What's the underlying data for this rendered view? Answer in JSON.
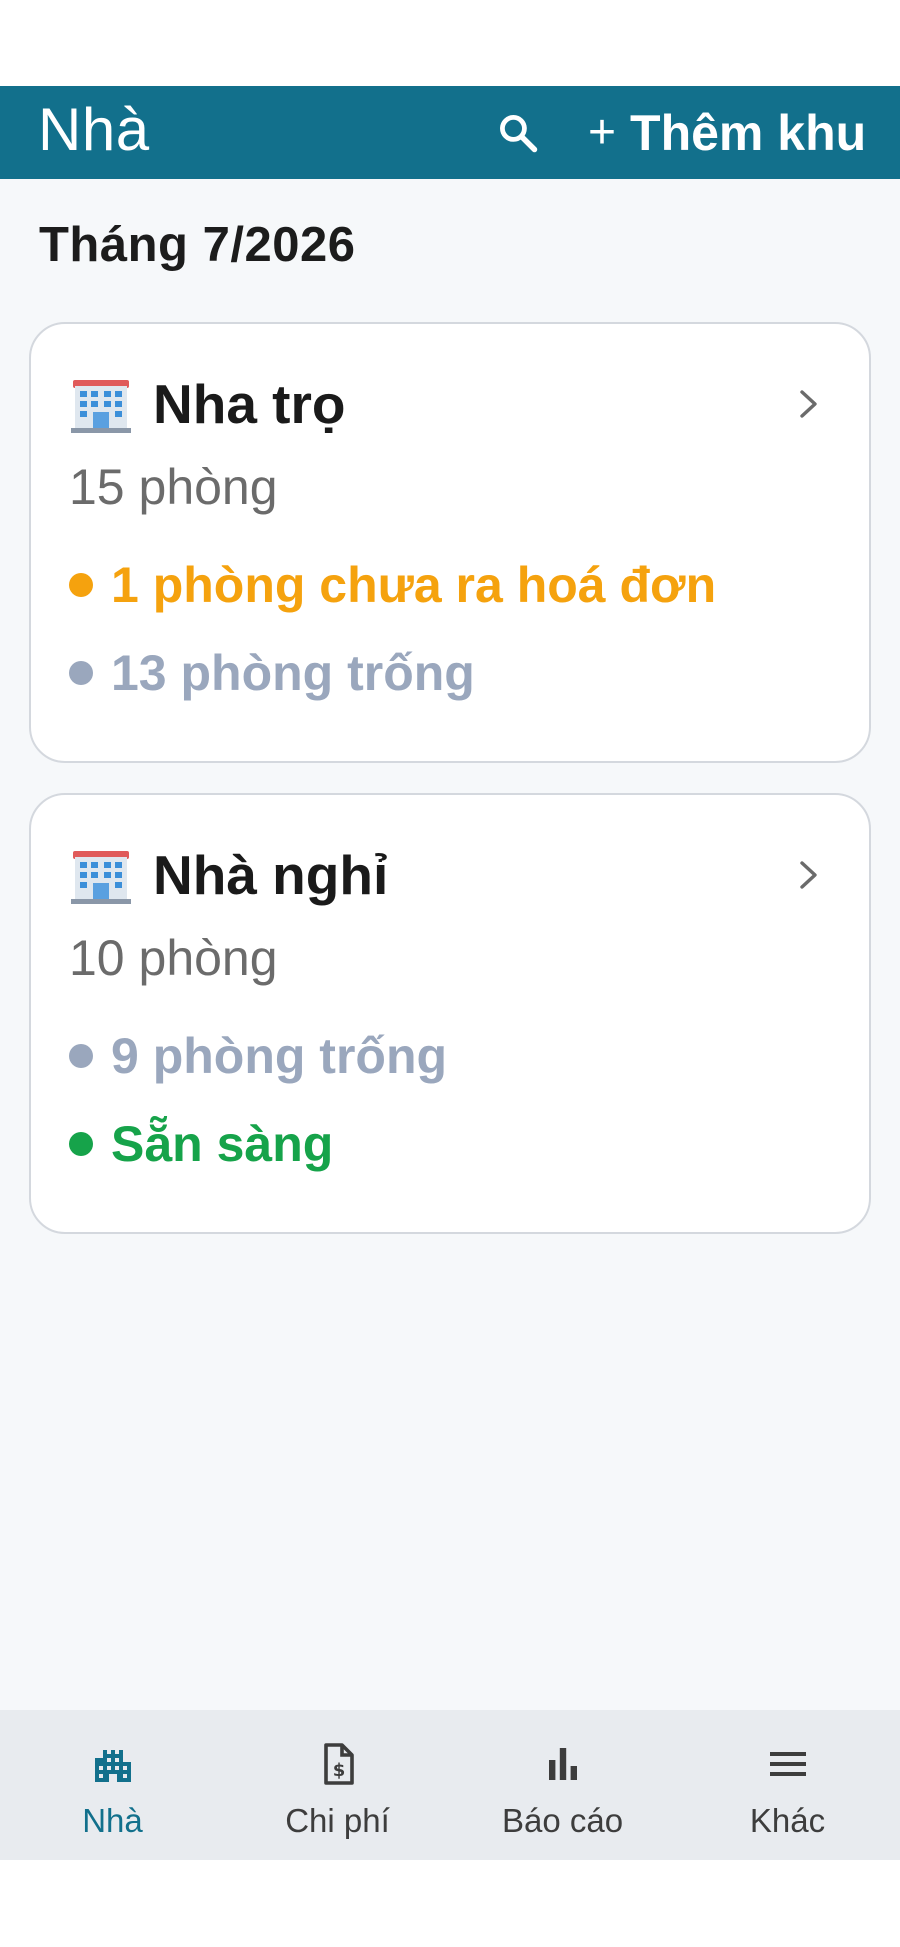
{
  "app_bar": {
    "title": "Nhà",
    "search_icon": "search-icon",
    "add_icon": "plus-icon",
    "add_label": "Thêm khu",
    "background": "#12708c"
  },
  "period": {
    "label": "Tháng 7/2026"
  },
  "areas": [
    {
      "icon": "office-building-icon",
      "name": "Nha trọ",
      "rooms": "15 phòng",
      "stats": [
        {
          "text": "1 phòng chưa ra hoá đơn",
          "color": "#f5a20e"
        },
        {
          "text": "13 phòng trống",
          "color": "#9aa7bd"
        }
      ]
    },
    {
      "icon": "office-building-icon",
      "name": "Nhà nghỉ",
      "rooms": "10 phòng",
      "stats": [
        {
          "text": "9 phòng trống",
          "color": "#9aa7bd"
        },
        {
          "text": "Sẵn sàng",
          "color": "#16a34a"
        }
      ]
    }
  ],
  "bottom_nav": {
    "items": [
      {
        "label": "Nhà",
        "icon": "building-icon",
        "active": true
      },
      {
        "label": "Chi phí",
        "icon": "receipt-dollar-icon",
        "active": false
      },
      {
        "label": "Báo cáo",
        "icon": "bar-chart-icon",
        "active": false
      },
      {
        "label": "Khác",
        "icon": "menu-icon",
        "active": false
      }
    ],
    "active_color": "#12708c"
  }
}
